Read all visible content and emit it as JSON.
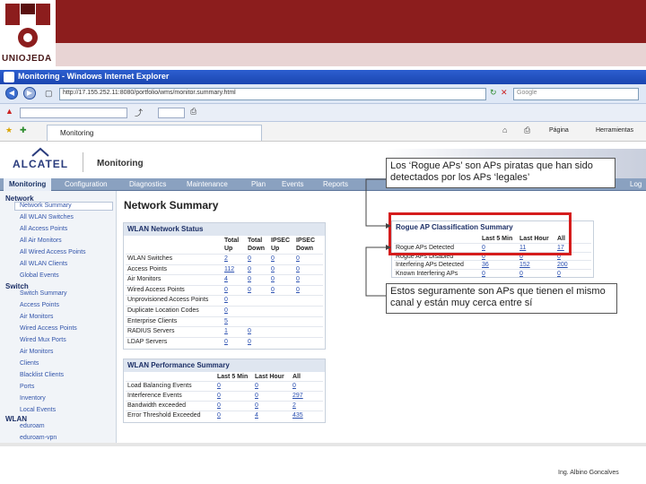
{
  "slide": {
    "logo_text": "UNIOJEDA",
    "credit": "Ing. Albino Goncalves"
  },
  "browser": {
    "title": "Monitoring - Windows Internet Explorer",
    "address": "http://17.155.252.11:8080/portfolio/wms/monitor.summary.html",
    "search_placeholder": "Google",
    "tab_label": "Monitoring",
    "menu_page": "Página",
    "menu_tools": "Herramientas"
  },
  "app": {
    "brand": "ALCATEL",
    "product": "Monitoring",
    "nav": [
      {
        "label": "Monitoring",
        "active": true
      },
      {
        "label": "Configuration"
      },
      {
        "label": "Diagnostics"
      },
      {
        "label": "Maintenance"
      },
      {
        "label": "Plan"
      },
      {
        "label": "Events"
      },
      {
        "label": "Reports"
      },
      {
        "label": "Log"
      }
    ]
  },
  "sidebar": {
    "network_head": "Network",
    "network_items": [
      "Network Summary",
      "All WLAN Switches",
      "All Access Points",
      "All Air Monitors",
      "All Wired Access Points",
      "All WLAN Clients",
      "Global Events"
    ],
    "switch_head": "Switch",
    "switch_items": [
      "Switch Summary",
      "Access Points",
      "Air Monitors",
      "Wired Access Points",
      "Wired Mux Ports",
      "Air Monitors",
      "Clients",
      "Blacklist Clients",
      "Ports",
      "Inventory",
      "Local Events"
    ],
    "wlan_head": "WLAN",
    "wlan_items": [
      "eduroam",
      "eduroam-vpn"
    ]
  },
  "main": {
    "page_title": "Network Summary",
    "wlan_status": {
      "title": "WLAN Network Status",
      "columns": [
        [
          "Total",
          "Up"
        ],
        [
          "Total",
          "Down"
        ],
        [
          "IPSEC",
          "Up"
        ],
        [
          "IPSEC",
          "Down"
        ]
      ],
      "rows": [
        {
          "label": "WLAN Switches",
          "values": [
            "2",
            "0",
            "0",
            "0"
          ]
        },
        {
          "label": "Access Points",
          "values": [
            "112",
            "0",
            "0",
            "0"
          ]
        },
        {
          "label": "Air Monitors",
          "values": [
            "4",
            "0",
            "0",
            "0"
          ]
        },
        {
          "label": "Wired Access Points",
          "values": [
            "0",
            "0",
            "0",
            "0"
          ]
        },
        {
          "label": "Unprovisioned Access Points",
          "values": [
            "0",
            "",
            "",
            ""
          ]
        },
        {
          "label": "Duplicate Location Codes",
          "values": [
            "0",
            "",
            "",
            ""
          ]
        },
        {
          "label": "Enterprise Clients",
          "values": [
            "5",
            "",
            "",
            ""
          ]
        },
        {
          "label": "RADIUS Servers",
          "values": [
            "1",
            "0",
            "",
            ""
          ]
        },
        {
          "label": "LDAP Servers",
          "values": [
            "0",
            "0",
            "",
            ""
          ]
        }
      ]
    },
    "wlan_perf": {
      "title": "WLAN Performance Summary",
      "columns": [
        "Last 5 Min",
        "Last Hour",
        "All"
      ],
      "rows": [
        {
          "label": "Load Balancing Events",
          "values": [
            "0",
            "0",
            "0"
          ]
        },
        {
          "label": "Interference Events",
          "values": [
            "0",
            "0",
            "297"
          ]
        },
        {
          "label": "Bandwidth exceeded",
          "values": [
            "0",
            "0",
            "2"
          ]
        },
        {
          "label": "Error Threshold Exceeded",
          "values": [
            "0",
            "4",
            "435"
          ]
        }
      ]
    },
    "rogue": {
      "title": "Rogue AP Classification Summary",
      "columns": [
        "Last 5 Min",
        "Last Hour",
        "All"
      ],
      "rows": [
        {
          "label": "Rogue APs Detected",
          "values": [
            "0",
            "11",
            "17"
          ]
        },
        {
          "label": "Rogue APs Disabled",
          "values": [
            "0",
            "0",
            "0"
          ]
        },
        {
          "label": "Interfering APs Detected",
          "values": [
            "36",
            "152",
            "200"
          ]
        },
        {
          "label": "Known Interfering APs",
          "values": [
            "0",
            "0",
            "0"
          ]
        }
      ]
    }
  },
  "annotations": {
    "callout_top": "Los ‘Rogue APs’ son APs piratas que han sido detectados por los APs ‘legales’",
    "callout_bottom": "Estos seguramente son APs que tienen el mismo canal y están muy cerca entre sí"
  },
  "colors": {
    "maroon": "#8c1d1d",
    "highlight_red": "#d51c1c",
    "nav_blue": "#8aa1c0"
  }
}
